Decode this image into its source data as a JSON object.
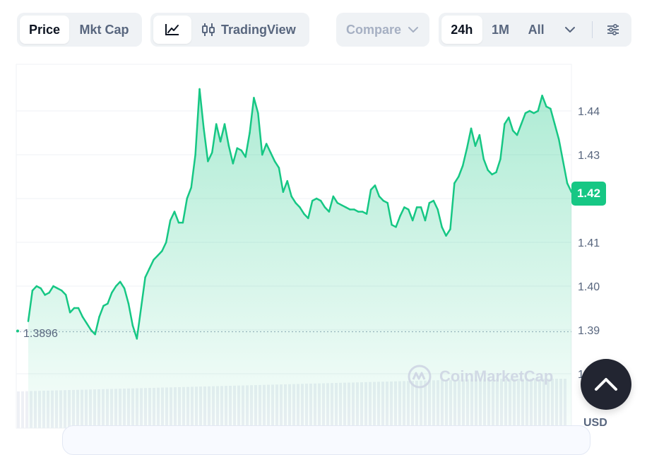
{
  "toolbar": {
    "price_tab": "Price",
    "mktcap_tab": "Mkt Cap",
    "tradingview_label": "TradingView",
    "compare_label": "Compare",
    "range_24h": "24h",
    "range_1m": "1M",
    "range_all": "All"
  },
  "icons": {
    "line_chart": "line-chart-icon",
    "candlestick": "candlestick-icon",
    "chevron": "chevron-down-icon",
    "settings": "sliders-icon",
    "scroll_top": "chevron-up-icon",
    "brand": "coinmarketcap-logo"
  },
  "watermark": "CoinMarketCap",
  "currency_label": "USD",
  "current_price_label": "1.42",
  "reference_price_label": "1.3896",
  "colors": {
    "up": "#16c784",
    "down": "#ea3943",
    "axis_text": "#58667e"
  },
  "chart_data": {
    "type": "area",
    "series": [
      {
        "values": [
          1.392,
          1.399,
          1.4,
          1.3995,
          1.398,
          1.3985,
          1.4,
          1.3995,
          1.399,
          1.398,
          1.394,
          1.395,
          1.395,
          1.393,
          1.3915,
          1.39,
          1.389,
          1.393,
          1.3955,
          1.396,
          1.3985,
          1.4,
          1.401,
          1.3995,
          1.396,
          1.391,
          1.388,
          1.395,
          1.402,
          1.404,
          1.406,
          1.407,
          1.408,
          1.41,
          1.415,
          1.417,
          1.4145,
          1.4145,
          1.42,
          1.4225,
          1.43,
          1.445,
          1.436,
          1.4285,
          1.4305,
          1.437,
          1.433,
          1.437,
          1.432,
          1.428,
          1.4315,
          1.431,
          1.4295,
          1.435,
          1.443,
          1.4395,
          1.43,
          1.4325,
          1.4305,
          1.4285,
          1.427,
          1.4215,
          1.424,
          1.4205,
          1.419,
          1.418,
          1.4165,
          1.4155,
          1.4195,
          1.42,
          1.4195,
          1.418,
          1.417,
          1.4205,
          1.419,
          1.4185,
          1.418,
          1.4175,
          1.4175,
          1.417,
          1.417,
          1.4165,
          1.422,
          1.423,
          1.4205,
          1.4195,
          1.419,
          1.414,
          1.4135,
          1.416,
          1.418,
          1.4175,
          1.415,
          1.418,
          1.418,
          1.415,
          1.419,
          1.4195,
          1.4175,
          1.4135,
          1.4115,
          1.413,
          1.4235,
          1.425,
          1.4275,
          1.4315,
          1.436,
          1.432,
          1.4345,
          1.429,
          1.4265,
          1.4255,
          1.426,
          1.429,
          1.437,
          1.4385,
          1.4355,
          1.4345,
          1.437,
          1.4395,
          1.44,
          1.4395,
          1.44,
          1.4435,
          1.441,
          1.4405,
          1.437,
          1.4335,
          1.4285,
          1.4235,
          1.4215
        ]
      }
    ],
    "ylim": [
      1.37,
      1.45
    ],
    "y_ticks": [
      1.38,
      1.39,
      1.4,
      1.41,
      1.42,
      1.43,
      1.44
    ],
    "y_tick_labels": [
      "1.38",
      "1.39",
      "1.40",
      "1.41",
      "1.42",
      "1.43",
      "1.44"
    ],
    "reference_value": 1.3896,
    "current_value": 1.42,
    "grid": true,
    "y_axis_position": "right",
    "x_labels_visible": false
  }
}
